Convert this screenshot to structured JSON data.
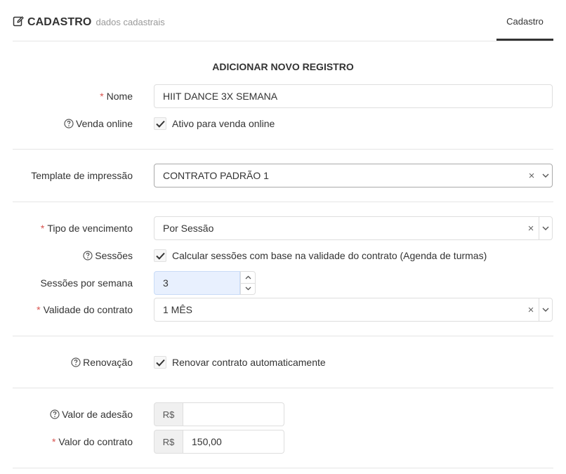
{
  "header": {
    "title": "CADASTRO",
    "subtitle": "dados cadastrais",
    "tab_label": "Cadastro"
  },
  "form": {
    "section_title": "ADICIONAR NOVO REGISTRO",
    "required_mark": "*",
    "nome": {
      "label": "Nome",
      "value": "HIIT DANCE 3X SEMANA"
    },
    "venda_online": {
      "label": "Venda online",
      "checkbox_label": "Ativo para venda online",
      "checked": true
    },
    "template": {
      "label": "Template de impressão",
      "value": "CONTRATO PADRÃO 1",
      "clear": "×"
    },
    "tipo_vencimento": {
      "label": "Tipo de vencimento",
      "value": "Por Sessão",
      "clear": "×"
    },
    "sessoes": {
      "label": "Sessões",
      "checkbox_label": "Calcular sessões com base na validade do contrato (Agenda de turmas)",
      "checked": true
    },
    "sessoes_semana": {
      "label": "Sessões por semana",
      "value": "3"
    },
    "validade": {
      "label": "Validade do contrato",
      "value": "1 MÊS",
      "clear": "×"
    },
    "renovacao": {
      "label": "Renovação",
      "checkbox_label": "Renovar contrato automaticamente",
      "checked": true
    },
    "valor_adesao": {
      "label": "Valor de adesão",
      "currency": "R$",
      "value": ""
    },
    "valor_contrato": {
      "label": "Valor do contrato",
      "currency": "R$",
      "value": "150,00"
    }
  },
  "colors": {
    "required": "#d9534f",
    "text": "#333333",
    "muted": "#999999",
    "autofill_bg": "#e8f0fe"
  },
  "icons": {
    "title": "edit-icon",
    "help": "question-circle-icon",
    "check": "check-icon",
    "select_open": "chevron-down-icon"
  }
}
